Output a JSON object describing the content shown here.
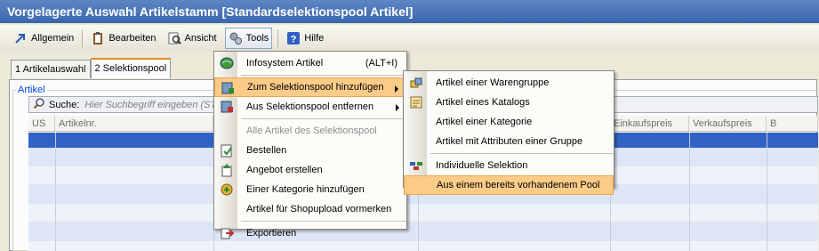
{
  "window": {
    "title": "Vorgelagerte Auswahl Artikelstamm [Standardselektionspool Artikel]"
  },
  "toolbar": {
    "items": [
      {
        "label": "Allgemein",
        "icon": "arrow-icon"
      },
      {
        "label": "Bearbeiten",
        "icon": "clipboard-icon"
      },
      {
        "label": "Ansicht",
        "icon": "view-icon"
      },
      {
        "label": "Tools",
        "icon": "tools-icon"
      },
      {
        "label": "Hilfe",
        "icon": "help-icon"
      }
    ]
  },
  "tabs": [
    {
      "label": "1 Artikelauswahl"
    },
    {
      "label": "2 Selektionspool"
    }
  ],
  "group": {
    "label": "Artikel"
  },
  "search": {
    "label": "Suche:",
    "placeholder": "Hier Suchbegriff eingeben (ST"
  },
  "grid": {
    "columns": [
      "US",
      "Artikelnr.",
      "",
      "",
      "Einkaufspreis",
      "Verkaufspreis",
      "B"
    ]
  },
  "tools_menu": {
    "items": [
      {
        "label": "Infosystem Artikel",
        "shortcut": "(ALT+I)"
      },
      {
        "label": "Zum Selektionspool hinzufügen"
      },
      {
        "label": "Aus Selektionspool entfernen"
      },
      {
        "label": "Alle Artikel des Selektionspool"
      },
      {
        "label": "Bestellen"
      },
      {
        "label": "Angebot erstellen"
      },
      {
        "label": "Einer Kategorie hinzufügen"
      },
      {
        "label": "Artikel für Shopupload vormerken"
      },
      {
        "label": "Exportieren"
      }
    ]
  },
  "submenu": {
    "items": [
      {
        "label": "Artikel einer Warengruppe"
      },
      {
        "label": "Artikel eines Katalogs"
      },
      {
        "label": "Artikel einer Kategorie"
      },
      {
        "label": "Artikel mit Attributen einer Gruppe"
      },
      {
        "label": "Individuelle Selektion"
      },
      {
        "label": "Aus einem bereits vorhandenem Pool"
      }
    ]
  },
  "colors": {
    "title_bar": "#3a66ad",
    "highlight": "#fbcb88",
    "selected_row": "#3162c5"
  }
}
